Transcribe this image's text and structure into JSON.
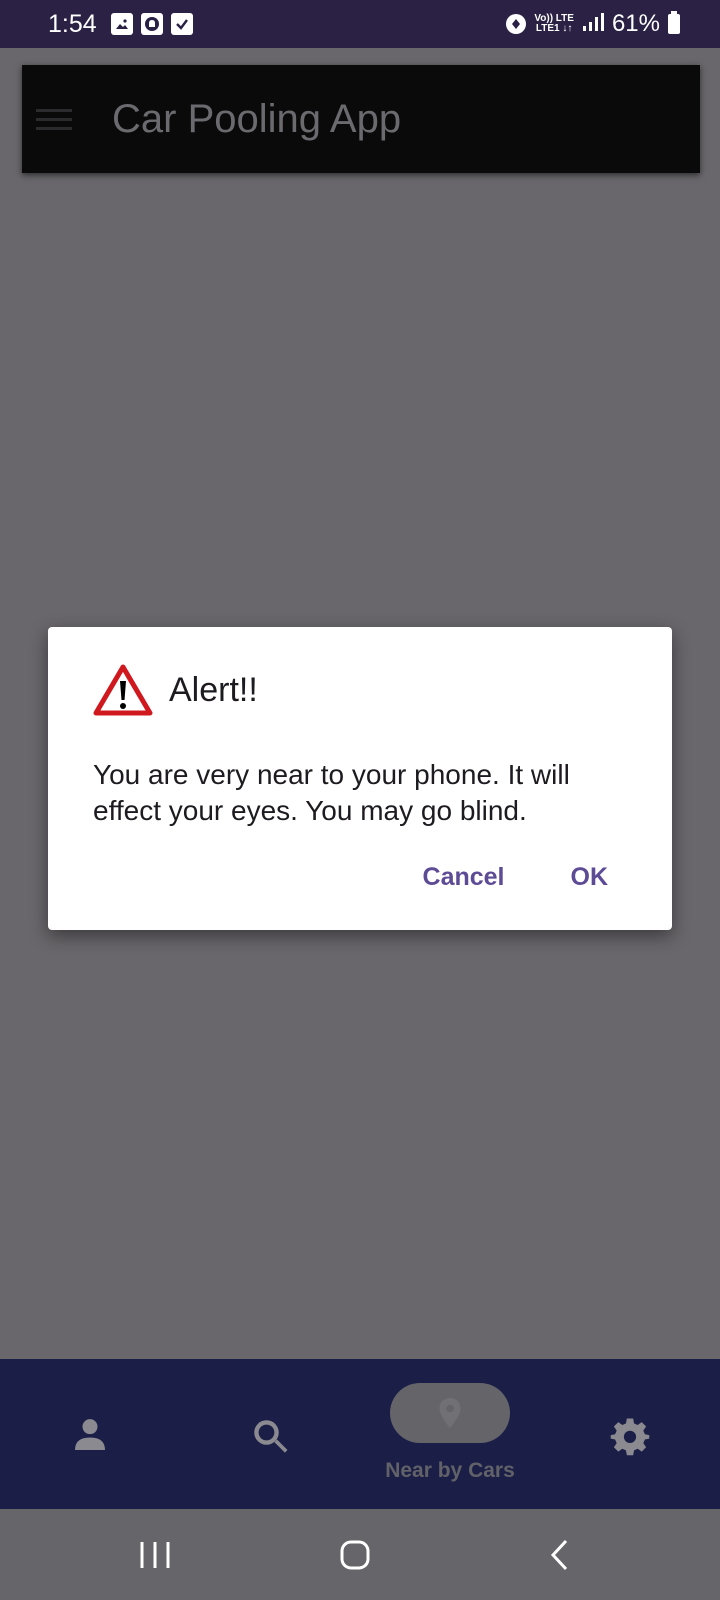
{
  "status_bar": {
    "time": "1:54",
    "network_top": "Vo)) LTE",
    "network_bottom": "LTE1 ↓↑",
    "battery": "61%",
    "icons": [
      "image-icon",
      "notification-icon",
      "checkbox-icon",
      "data-saver-icon",
      "signal-icon",
      "battery-icon"
    ]
  },
  "app_bar": {
    "title": "Car Pooling App",
    "menu_icon": "menu-icon"
  },
  "dialog": {
    "icon": "warning-icon",
    "title": "Alert!!",
    "message": "You are very near to your phone. It will effect your eyes. You may go blind.",
    "cancel_label": "Cancel",
    "ok_label": "OK"
  },
  "bottom_nav": {
    "items": [
      {
        "icon": "person-icon",
        "label": ""
      },
      {
        "icon": "search-icon",
        "label": ""
      },
      {
        "icon": "location-pin-icon",
        "label": "Near by Cars",
        "selected": true
      },
      {
        "icon": "gear-icon",
        "label": ""
      }
    ]
  },
  "colors": {
    "status_bar": "#2a2144",
    "app_bar": "#0a0a0b",
    "scrim": "#69676b",
    "dialog_button": "#5e4b96",
    "warning_red": "#d0191f",
    "bottom_nav": "#1b1f48"
  }
}
